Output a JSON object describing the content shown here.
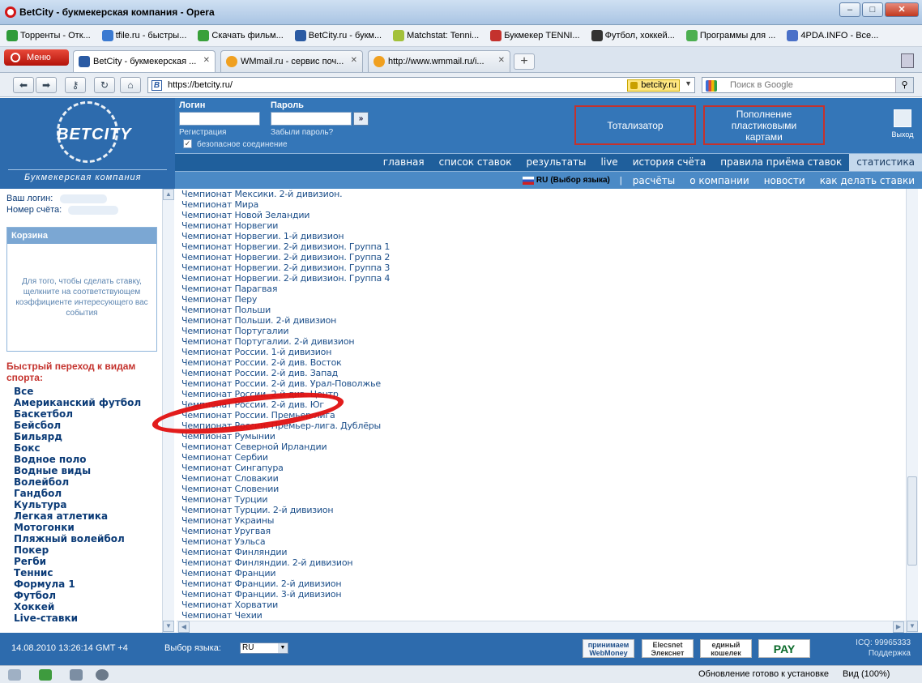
{
  "window": {
    "title": "BetCity - букмекерская компания - Opera",
    "min": "–",
    "max": "□",
    "close": "✕"
  },
  "bookmarks": [
    {
      "label": "Торренты - Отк...",
      "icon": "torrent-icon",
      "color": "#2f9b3a"
    },
    {
      "label": "tfile.ru - быстры...",
      "icon": "tfile-icon",
      "color": "#3b7ad1"
    },
    {
      "label": "Скачать фильм...",
      "icon": "leaf-icon",
      "color": "#39a03a"
    },
    {
      "label": "BetCity.ru - букм...",
      "icon": "betcity-icon",
      "color": "#2a5aa3"
    },
    {
      "label": "Matchstat: Tenni...",
      "icon": "tennis-ball-icon",
      "color": "#a3c13a"
    },
    {
      "label": "Букмекер TENNI...",
      "icon": "bookmaker-icon",
      "color": "#c4322d"
    },
    {
      "label": "Футбол, хоккей...",
      "icon": "soccer-ball-icon",
      "color": "#333333"
    },
    {
      "label": "Программы для ...",
      "icon": "programs-icon",
      "color": "#4caf50"
    },
    {
      "label": "4PDA.INFO - Все...",
      "icon": "pda-icon",
      "color": "#4a70c8"
    }
  ],
  "menu_label": "Меню",
  "tabs": [
    {
      "label": "BetCity - букмекерская ...",
      "icon": "betcity-icon",
      "active": true
    },
    {
      "label": "WMmail.ru - сервис поч...",
      "icon": "wmmail-icon",
      "active": false
    },
    {
      "label": "http://www.wmmail.ru/i...",
      "icon": "wmmail-icon",
      "active": false
    }
  ],
  "address": {
    "url": "https://betcity.ru/",
    "secure_badge": "betcity.ru",
    "search_placeholder": "Поиск в Google"
  },
  "header": {
    "login_label": "Логин",
    "password_label": "Пароль",
    "register_link": "Регистрация",
    "forgot_link": "Забыли пароль?",
    "secure_label": "безопасное соединение",
    "go": "»",
    "totalizator": "Тотализатор",
    "topup": "Пополнение пластиковыми картами",
    "exit": "Выход",
    "logo_sub": "Букмекерская компания"
  },
  "main_nav": [
    "главная",
    "список ставок",
    "результаты",
    "live",
    "история счёта",
    "правила приёма ставок",
    "статистика"
  ],
  "main_nav_active": "статистика",
  "sub_nav": {
    "lang": "RU",
    "lang_hint": "(Выбор языка)",
    "items": [
      "расчёты",
      "о компании",
      "новости",
      "как делать ставки"
    ]
  },
  "sidebar": {
    "login_label": "Ваш логин:",
    "account_label": "Номер счёта:",
    "basket_title": "Корзина",
    "basket_text": "Для того, чтобы сделать ставку, щелкните на соответствующем коэффициенте интересующего вас события",
    "sports_title": "Быстрый переход к видам спорта:",
    "sports": [
      "Все",
      "Американский футбол",
      "Баскетбол",
      "Бейсбол",
      "Бильярд",
      "Бокс",
      "Водное поло",
      "Водные виды",
      "Волейбол",
      "Гандбол",
      "Культура",
      "Легкая атлетика",
      "Мотогонки",
      "Пляжный волейбол",
      "Покер",
      "Регби",
      "Теннис",
      "Формула 1",
      "Футбол",
      "Хоккей",
      "Live-ставки"
    ]
  },
  "championships": [
    "Чемпионат Мексики. 2-й дивизион.",
    "Чемпионат Мира",
    "Чемпионат Новой Зеландии",
    "Чемпионат Норвегии",
    "Чемпионат Норвегии. 1-й дивизион",
    "Чемпионат Норвегии. 2-й дивизион. Группа 1",
    "Чемпионат Норвегии. 2-й дивизион. Группа 2",
    "Чемпионат Норвегии. 2-й дивизион. Группа 3",
    "Чемпионат Норвегии. 2-й дивизион. Группа 4",
    "Чемпионат Парагвая",
    "Чемпионат Перу",
    "Чемпионат Польши",
    "Чемпионат Польши. 2-й дивизион",
    "Чемпионат Португалии",
    "Чемпионат Португалии. 2-й дивизион",
    "Чемпионат России. 1-й дивизион",
    "Чемпионат России. 2-й див. Восток",
    "Чемпионат России. 2-й див. Запад",
    "Чемпионат России. 2-й див. Урал-Поволжье",
    "Чемпионат России. 2-й див. Центр",
    "Чемпионат России. 2-й див. Юг",
    "Чемпионат России. Премьер-лига",
    "Чемпионат России. Премьер-лига. Дублёры",
    "Чемпионат Румынии",
    "Чемпионат Северной Ирландии",
    "Чемпионат Сербии",
    "Чемпионат Сингапура",
    "Чемпионат Словакии",
    "Чемпионат Словении",
    "Чемпионат Турции",
    "Чемпионат Турции. 2-й дивизион",
    "Чемпионат Украины",
    "Чемпионат Уругвая",
    "Чемпионат Уэльса",
    "Чемпионат Финляндии",
    "Чемпионат Финляндии. 2-й дивизион",
    "Чемпионат Франции",
    "Чемпионат Франции. 2-й дивизион",
    "Чемпионат Франции. 3-й дивизион",
    "Чемпионат Хорватии",
    "Чемпионат Чехии"
  ],
  "footer": {
    "datetime": "14.08.2010  13:26:14  GMT +4",
    "lang_label": "Выбор языка:",
    "lang_value": "RU",
    "webmoney_top": "принимаем",
    "webmoney": "WebMoney",
    "elecsnet": "Elecsnet Элекснет",
    "wallet": "единый кошелек",
    "liqpay": "PAY",
    "icq": "ICQ: 99965333",
    "support": "Поддержка"
  },
  "status": {
    "update": "Обновление готово к установке",
    "zoom": "Вид (100%)"
  }
}
